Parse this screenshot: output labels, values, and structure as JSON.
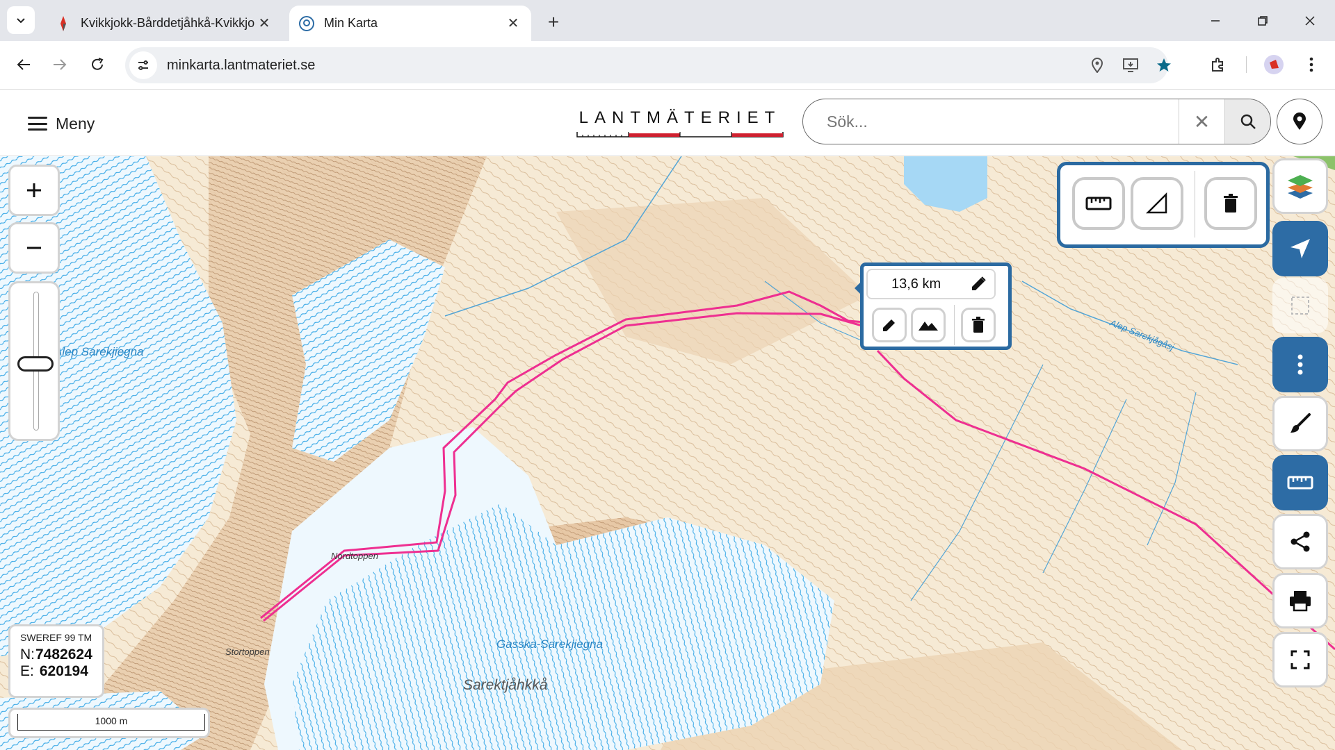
{
  "browser": {
    "tabs": [
      {
        "title": "Kvikkjokk-Bårddetjåhkå-Kvikkjokk",
        "active": false
      },
      {
        "title": "Min Karta",
        "active": true
      }
    ],
    "url": "minkarta.lantmateriet.se"
  },
  "header": {
    "menu_label": "Meny",
    "logo_text": "LANTMÄTERIET",
    "search_placeholder": "Sök...",
    "search_value": ""
  },
  "map": {
    "place_labels": {
      "alep_sarekjiegna": "Alep Sarekjiegna",
      "nordtoppen": "Nordtoppen",
      "stortoppen": "Stortoppen",
      "gasska_sarekjiegna": "Gasska-Sarekjiegna",
      "sarektjahkka": "Sarektjåhkkå",
      "alep_sarekjagasj": "Alep Sarekjågåsj"
    },
    "measurement": {
      "distance": "13,6 km"
    },
    "coordinates": {
      "system": "SWEREF 99 TM",
      "north_label": "N:",
      "north": "7482624",
      "east_label": "E:",
      "east": "620194"
    },
    "scale_label": "1000 m",
    "colors": {
      "accent": "#2d6ca5",
      "route": "#ee2f91",
      "glacier": "#4fb3e8",
      "terrain": "#f5e7cf",
      "contour": "#c9a27e"
    }
  },
  "icons": {
    "zoom_in": "plus-icon",
    "zoom_out": "minus-icon",
    "layers": "layers-icon",
    "navigate": "navigation-arrow-icon",
    "select": "selection-icon",
    "more": "more-vertical-icon",
    "draw": "brush-icon",
    "measure": "ruler-icon",
    "share": "share-icon",
    "print": "printer-icon",
    "fullscreen": "fullscreen-icon"
  }
}
